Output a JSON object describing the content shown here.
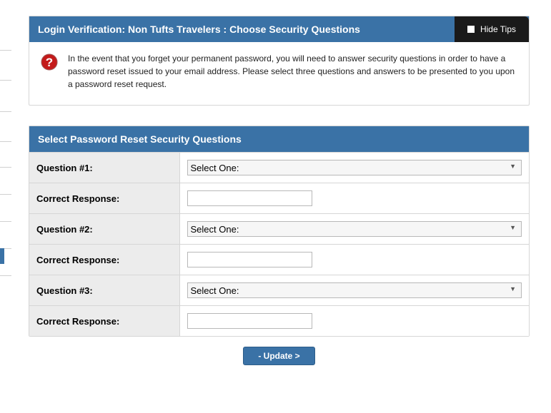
{
  "header": {
    "title": "Login Verification: Non Tufts Travelers : Choose Security Questions",
    "hide_tips_label": "Hide Tips"
  },
  "tip": {
    "text": "In the event that you forget your permanent password, you will need to answer security questions in order to have a password reset issued to your email address. Please select three questions and answers to be presented to you upon a password reset request."
  },
  "form": {
    "title": "Select Password Reset Security Questions",
    "rows": {
      "q1_label": "Question #1:",
      "r1_label": "Correct Response:",
      "q2_label": "Question #2:",
      "r2_label": "Correct Response:",
      "q3_label": "Question #3:",
      "r3_label": "Correct Response:"
    },
    "select_placeholder": "Select One:",
    "response_value": ""
  },
  "footer": {
    "update_label": "- Update >"
  }
}
